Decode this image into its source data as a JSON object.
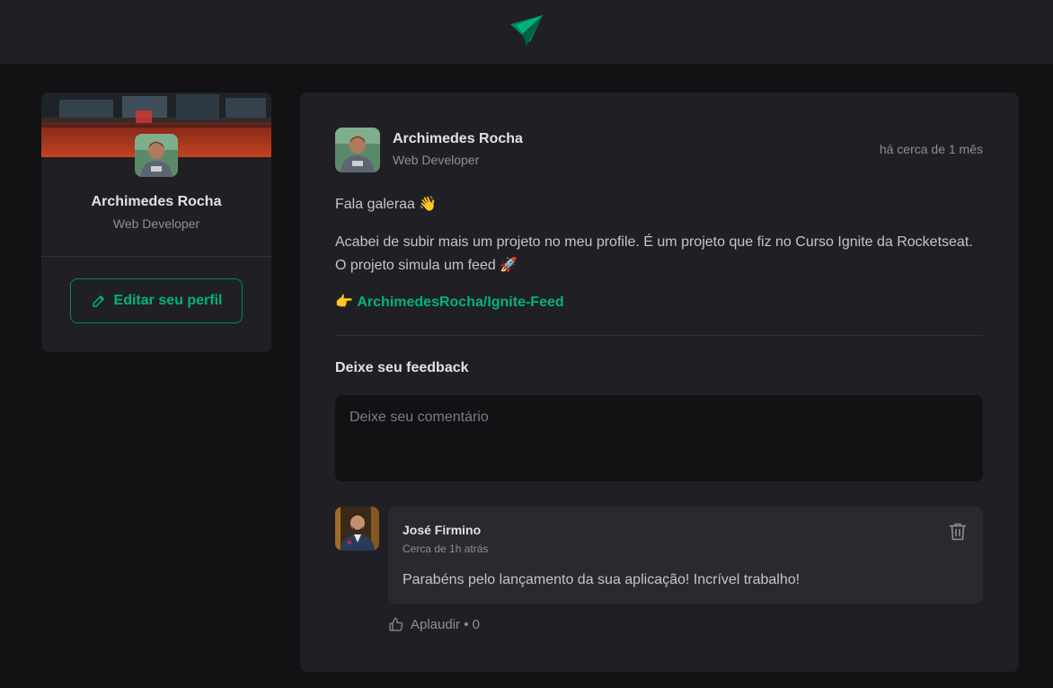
{
  "header": {
    "logo_icon": "paper-plane-logo-icon"
  },
  "sidebar": {
    "name": "Archimedes Rocha",
    "role": "Web Developer",
    "edit_button": "Editar seu perfil"
  },
  "post": {
    "author": "Archimedes Rocha",
    "role": "Web Developer",
    "time": "há cerca de 1 mês",
    "greeting": "Fala galeraa 👋",
    "body": "Acabei de subir mais um projeto no meu profile. É um projeto que fiz no Curso Ignite da Rocketseat. O projeto simula um feed 🚀",
    "link_prefix": "👉 ",
    "link_text": "ArchimedesRocha/Ignite-Feed",
    "feedback_title": "Deixe seu feedback",
    "comment_placeholder": "Deixe seu comentário"
  },
  "comments": [
    {
      "author": "José Firmino",
      "time": "Cerca de 1h atrás",
      "text": "Parabéns pelo lançamento da sua aplicação! Incrível trabalho!",
      "applaud_label": "Aplaudir",
      "applaud_separator": " • ",
      "applaud_count": "0"
    }
  ],
  "colors": {
    "accent": "#00b37e",
    "accent_border": "#00875f",
    "background": "#121214",
    "card": "#202024",
    "comment_bg": "#29292e"
  }
}
